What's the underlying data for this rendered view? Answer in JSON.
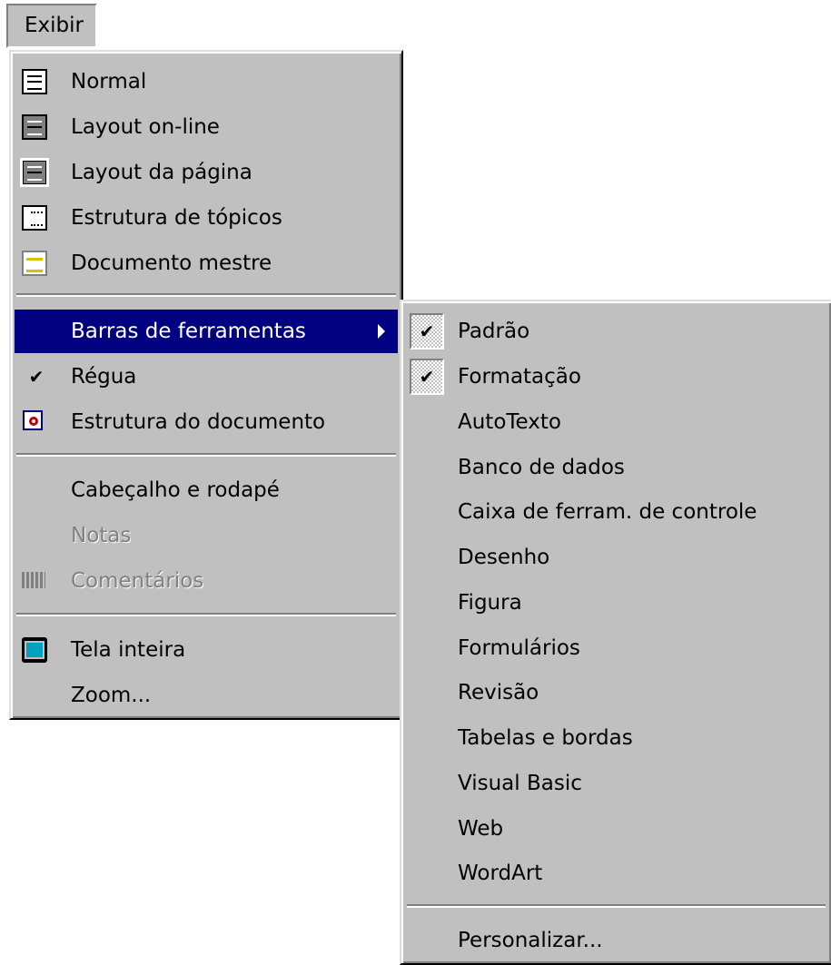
{
  "menubar": {
    "title": "Exibir"
  },
  "main_menu": {
    "items": [
      {
        "label": "Normal",
        "icon": "normal-view-icon"
      },
      {
        "label": "Layout on-line",
        "icon": "online-layout-icon"
      },
      {
        "label": "Layout da página",
        "icon": "page-layout-icon"
      },
      {
        "label": "Estrutura de tópicos",
        "icon": "outline-view-icon"
      },
      {
        "label": "Documento mestre",
        "icon": "master-document-icon"
      },
      {
        "label": "Barras de ferramentas",
        "submenu": true
      },
      {
        "label": "Régua",
        "checked": true
      },
      {
        "label": "Estrutura do documento",
        "icon": "document-map-icon"
      },
      {
        "label": "Cabeçalho e rodapé"
      },
      {
        "label": "Notas",
        "disabled": true
      },
      {
        "label": "Comentários",
        "disabled": true,
        "icon": "comments-icon"
      },
      {
        "label": "Tela inteira",
        "icon": "full-screen-icon"
      },
      {
        "label": "Zoom..."
      }
    ]
  },
  "submenu": {
    "items": [
      {
        "label": "Padrão",
        "checked": true
      },
      {
        "label": "Formatação",
        "checked": true
      },
      {
        "label": "AutoTexto"
      },
      {
        "label": "Banco de dados"
      },
      {
        "label": "Caixa de ferram. de controle"
      },
      {
        "label": "Desenho"
      },
      {
        "label": "Figura"
      },
      {
        "label": "Formulários"
      },
      {
        "label": "Revisão"
      },
      {
        "label": "Tabelas e bordas"
      },
      {
        "label": "Visual Basic"
      },
      {
        "label": "Web"
      },
      {
        "label": "WordArt"
      },
      {
        "label": "Personalizar..."
      }
    ]
  },
  "colors": {
    "menu_bg": "#c0c0c0",
    "highlight": "#000080",
    "disabled_text": "#808080"
  }
}
